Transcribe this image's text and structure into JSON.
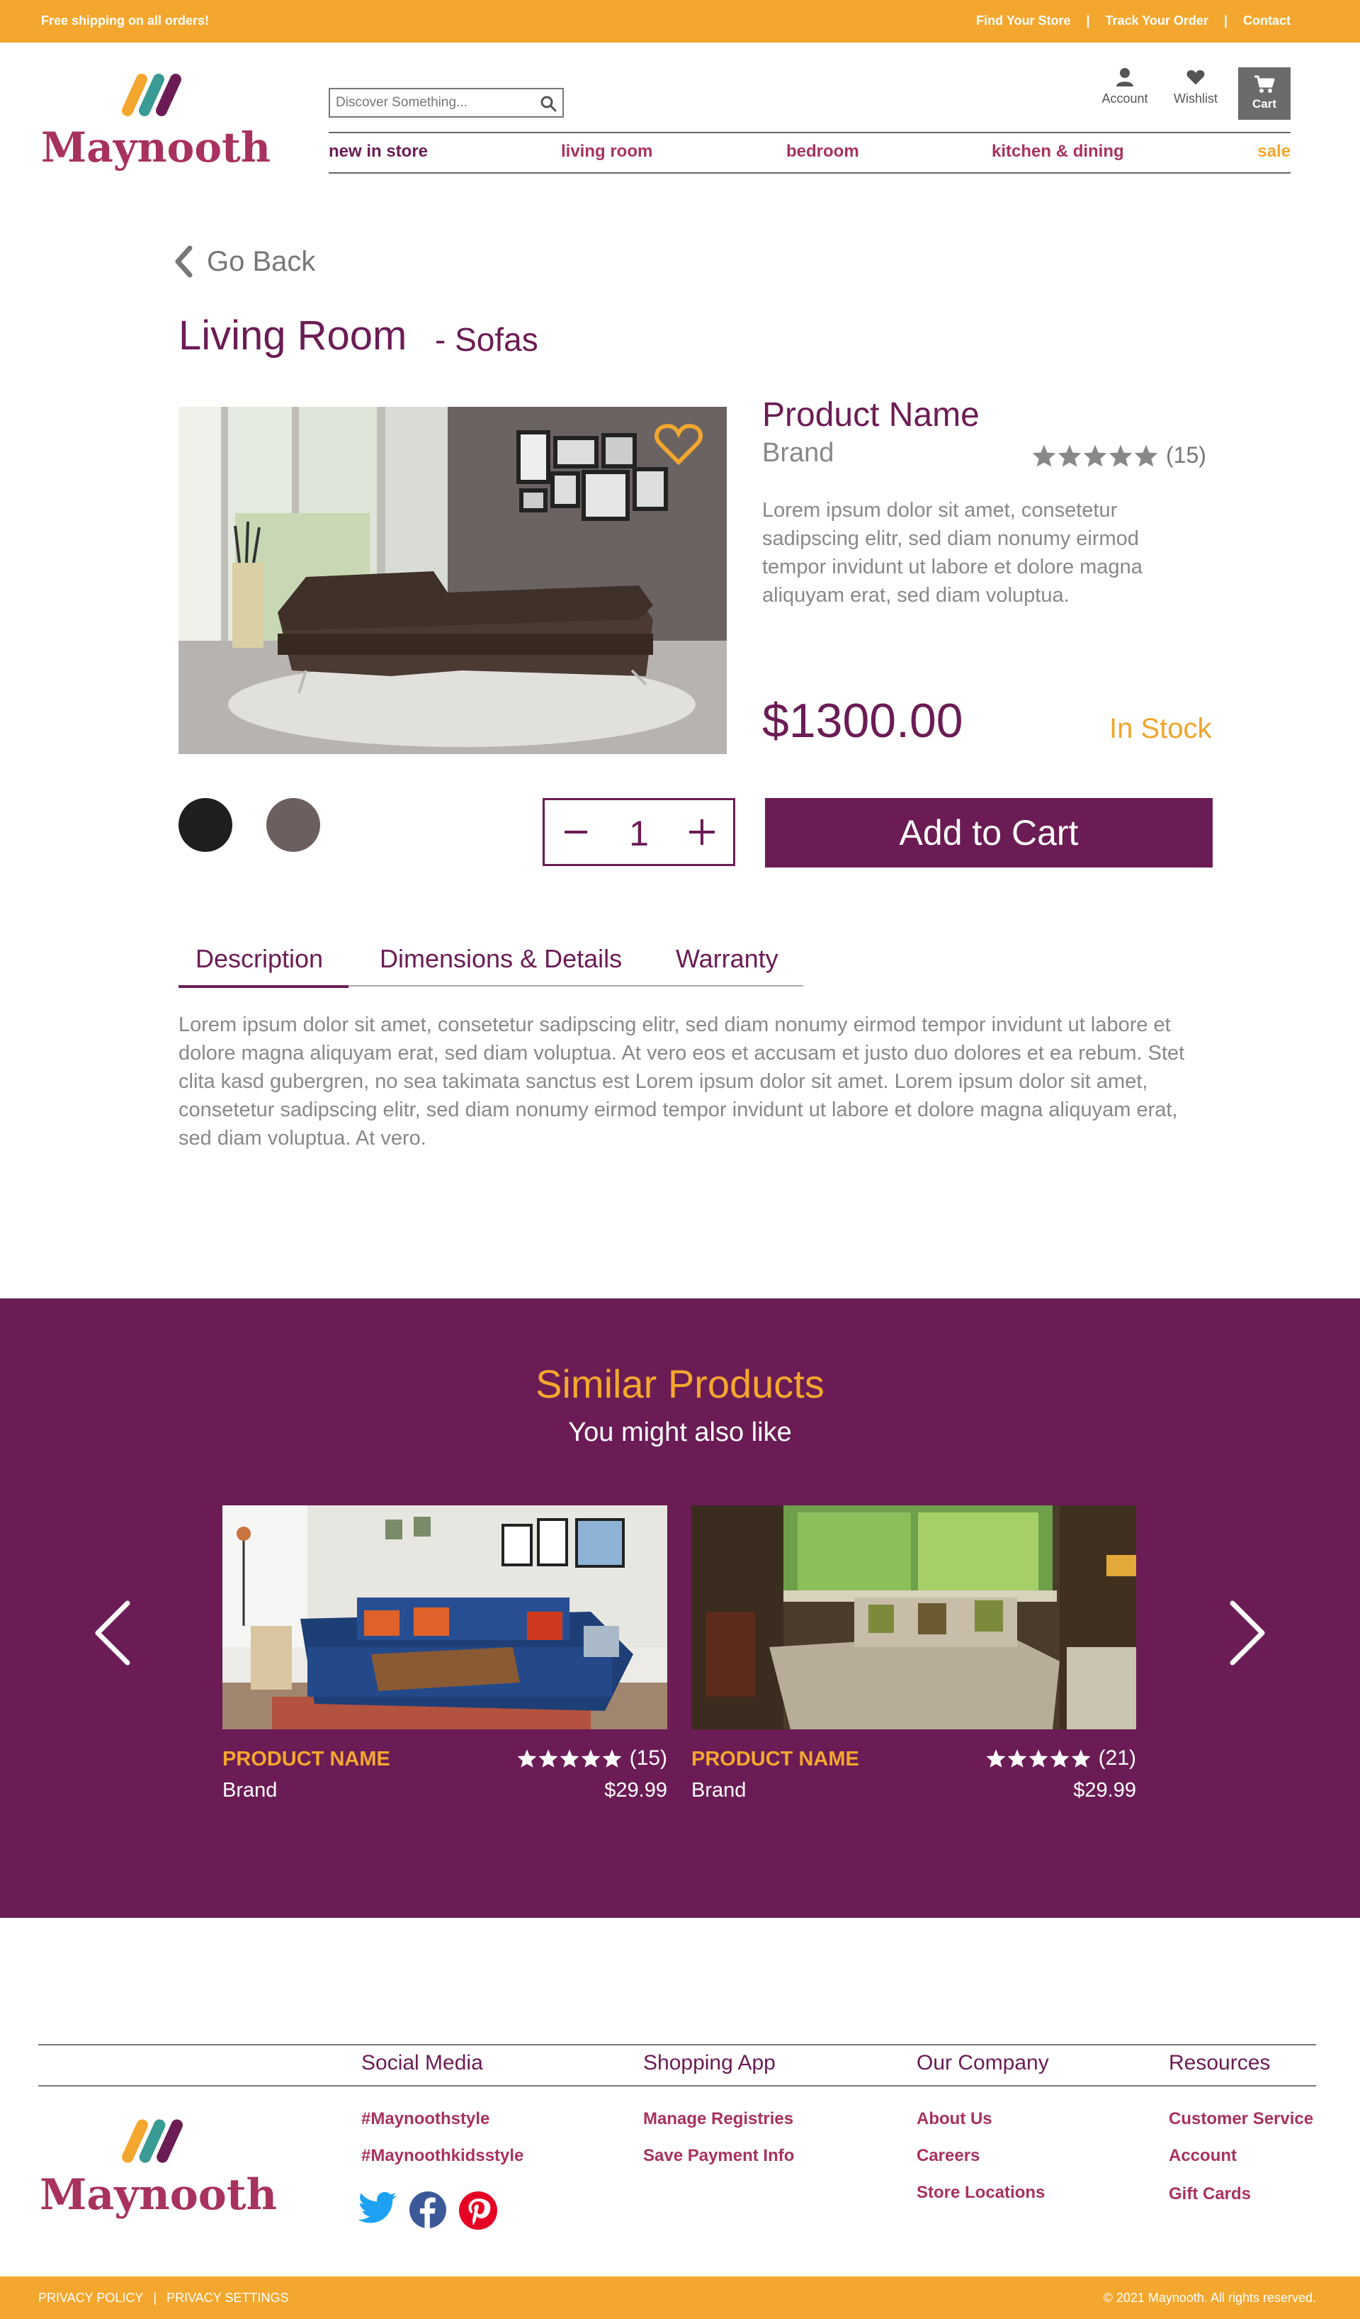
{
  "topbar": {
    "promo": "Free shipping on all orders!",
    "links": [
      "Find Your Store",
      "Track Your Order",
      "Contact"
    ],
    "separator": "|"
  },
  "brand": {
    "name": "Maynooth",
    "logo_colors": [
      "#f4a72e",
      "#3a9a94",
      "#6b1c55"
    ],
    "name_color": "#a8325e"
  },
  "search": {
    "placeholder": "Discover Something...",
    "icon": "search-icon"
  },
  "utilities": {
    "account": "Account",
    "wishlist": "Wishlist",
    "cart": "Cart"
  },
  "nav": {
    "items": [
      "new in store",
      "living room",
      "bedroom",
      "kitchen & dining",
      "sale"
    ],
    "sale_color": "#f4a72e"
  },
  "page": {
    "back": "Go Back",
    "category": "Living Room",
    "subcategory": "- Sofas"
  },
  "product": {
    "name": "Product Name",
    "brand": "Brand",
    "rating": 5,
    "review_count": "(15)",
    "description": "Lorem ipsum dolor sit amet, consetetur sadipscing elitr, sed diam nonumy eirmod tempor invidunt ut labore et dolore magna aliquyam erat, sed diam voluptua.",
    "price": "$1300.00",
    "stock": "In Stock",
    "swatches": [
      "#1f1f1f",
      "#6b5f60"
    ],
    "quantity": "1",
    "add_to_cart": "Add to Cart"
  },
  "tabs": {
    "items": [
      "Description",
      "Dimensions & Details",
      "Warranty"
    ],
    "active": "Description",
    "content": "Lorem ipsum dolor sit amet, consetetur sadipscing elitr, sed diam nonumy eirmod tempor invidunt ut labore et dolore magna aliquyam erat, sed diam voluptua. At vero eos et accusam et justo duo dolores et ea rebum. Stet clita kasd gubergren, no sea takimata sanctus est Lorem ipsum dolor sit amet. Lorem ipsum dolor sit amet, consetetur sadipscing elitr, sed diam nonumy eirmod tempor invidunt ut labore et dolore magna aliquyam erat, sed diam voluptua. At vero."
  },
  "similar": {
    "title": "Similar Products",
    "subtitle": "You might also like",
    "products": [
      {
        "name": "PRODUCT NAME",
        "brand": "Brand",
        "rating": 5,
        "reviews": "(15)",
        "price": "$29.99"
      },
      {
        "name": "PRODUCT NAME",
        "brand": "Brand",
        "rating": 5,
        "reviews": "(21)",
        "price": "$29.99"
      }
    ]
  },
  "footer": {
    "columns": [
      {
        "title": "Social Media",
        "links": [
          "#Maynoothstyle",
          "#Maynoothkidsstyle"
        ]
      },
      {
        "title": "Shopping App",
        "links": [
          "Manage Registries",
          "Save Payment Info"
        ]
      },
      {
        "title": "Our Company",
        "links": [
          "About Us",
          "Careers",
          "Store Locations"
        ]
      },
      {
        "title": "Resources",
        "links": [
          "Customer Service",
          "Account",
          "Gift Cards"
        ]
      }
    ],
    "social_icons": [
      "twitter-icon",
      "facebook-icon",
      "pinterest-icon"
    ],
    "legal": [
      "PRIVACY POLICY",
      "PRIVACY SETTINGS"
    ],
    "separator": "|",
    "copyright": "© 2021 Maynooth. All rights reserved."
  },
  "colors": {
    "accent": "#f4a72e",
    "primary": "#6b1c55",
    "link": "#a8325e",
    "muted": "#888888"
  }
}
